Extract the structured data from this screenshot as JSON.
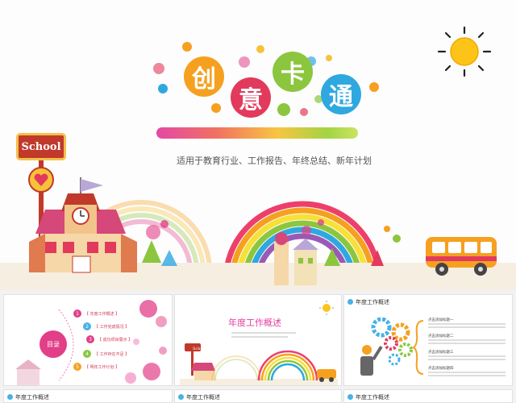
{
  "main_slide": {
    "title_chars": [
      "创",
      "意",
      "卡",
      "通"
    ],
    "title_colors": [
      "#f6a020",
      "#e23a5c",
      "#8cc63f",
      "#2fa8e0"
    ],
    "subtitle": "适用于教育行业、工作报告、年终总结、新年计划",
    "school_sign": "School"
  },
  "thumbnails": {
    "toc": {
      "center_label": "目录",
      "items": [
        {
          "num": "1",
          "label": "【 年度工作概述 】",
          "color": "#e23f88"
        },
        {
          "num": "2",
          "label": "【 工作完成情况 】",
          "color": "#47b2e6"
        },
        {
          "num": "3",
          "label": "【 成功项目展示 】",
          "color": "#e23f88"
        },
        {
          "num": "4",
          "label": "【 工作存在不足 】",
          "color": "#8cc63f"
        },
        {
          "num": "5",
          "label": "【 明年工作计划 】",
          "color": "#f6a020"
        }
      ]
    },
    "section": {
      "title": "年度工作概述"
    },
    "overview": {
      "header": "年度工作概述",
      "rows": [
        {
          "label": "点击添加标题一"
        },
        {
          "label": "点击添加标题二"
        },
        {
          "label": "点击添加标题三"
        },
        {
          "label": "点击添加标题四"
        }
      ]
    },
    "bottom_headers": [
      "年度工作概述",
      "年度工作概述",
      "年度工作概述"
    ]
  }
}
